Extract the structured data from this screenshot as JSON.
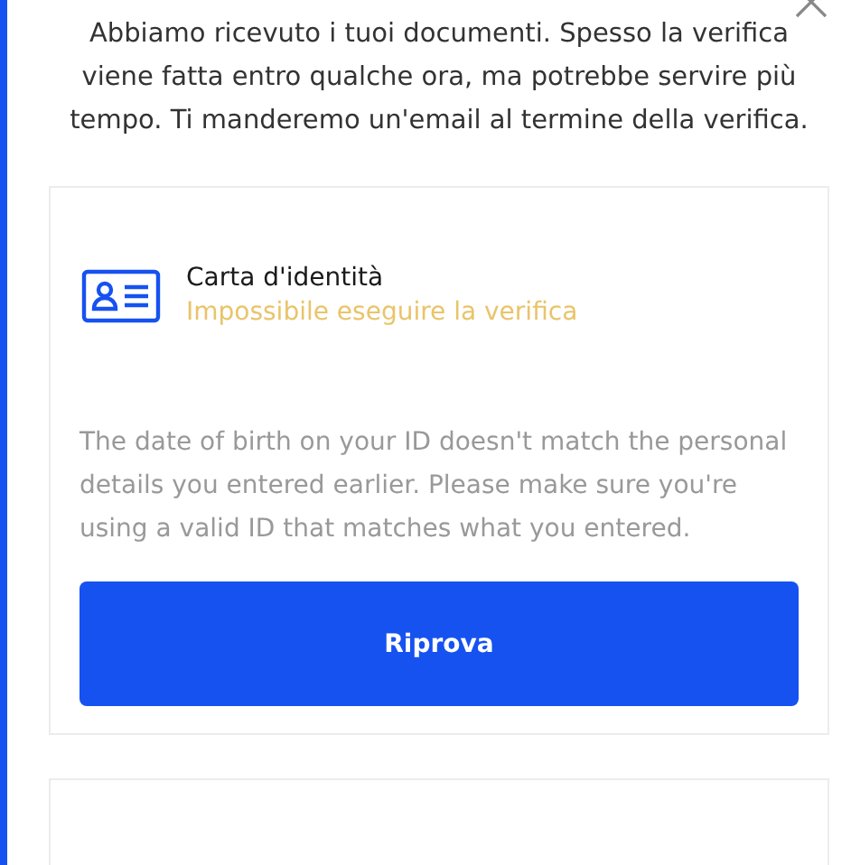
{
  "intro": "Abbiamo ricevuto i tuoi documenti. Spesso la verifica viene fatta entro qualche ora, ma potrebbe servire più tempo. Ti manderemo un'email al termine della verifica.",
  "documents": [
    {
      "title": "Carta d'identità",
      "status": {
        "text": "Impossibile eseguire la verifica",
        "kind": "failed"
      },
      "message": "The date of birth on your ID doesn't match the personal details you entered earlier. Please make sure you're using a valid ID that matches what you entered.",
      "button": "Riprova"
    }
  ]
}
